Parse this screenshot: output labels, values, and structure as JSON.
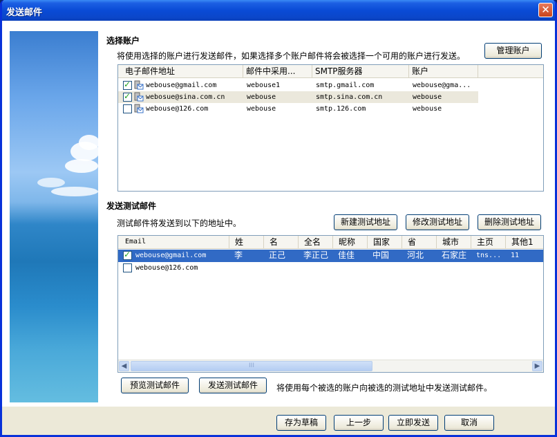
{
  "window": {
    "title": "发送邮件",
    "close_label": "✕"
  },
  "accounts_section": {
    "title": "选择账户",
    "description": "将使用选择的账户进行发送邮件，如果选择多个账户邮件将会被选择一个可用的账户进行发送。",
    "manage_button": "管理账户",
    "columns": [
      "电子邮件地址",
      "邮件中采用...",
      "SMTP服务器",
      "账户"
    ],
    "rows": [
      {
        "checked": true,
        "email": "webouse@gmail.com",
        "name": "webouse1",
        "smtp": "smtp.gmail.com",
        "account": "webouse@gma..."
      },
      {
        "checked": true,
        "email": "webosue@sina.com.cn",
        "name": "webouse",
        "smtp": "smtp.sina.com.cn",
        "account": "webouse"
      },
      {
        "checked": false,
        "email": "webouse@126.com",
        "name": "webouse",
        "smtp": "smtp.126.com",
        "account": "webouse"
      }
    ]
  },
  "test_section": {
    "title": "发送测试邮件",
    "description": "测试邮件将发送到以下的地址中。",
    "new_button": "新建测试地址",
    "edit_button": "修改测试地址",
    "delete_button": "删除测试地址",
    "columns": [
      "Email",
      "姓",
      "名",
      "全名",
      "昵称",
      "国家",
      "省",
      "城市",
      "主页",
      "其他1"
    ],
    "rows": [
      {
        "checked": true,
        "selected": true,
        "cells": [
          "webouse@gmail.com",
          "李",
          "正己",
          "李正己",
          "佳佳",
          "中国",
          "河北",
          "石家庄",
          "tns...",
          "11"
        ]
      },
      {
        "checked": false,
        "selected": false,
        "cells": [
          "webouse@126.com",
          "",
          "",
          "",
          "",
          "",
          "",
          "",
          "",
          ""
        ]
      }
    ],
    "scroll_grip": "III",
    "preview_button": "预览测试邮件",
    "send_test_button": "发送测试邮件",
    "send_note": "将使用每个被选的账户向被选的测试地址中发送测试邮件。"
  },
  "footer": {
    "save_draft": "存为草稿",
    "previous": "上一步",
    "send_now": "立即发送",
    "cancel": "取消"
  },
  "colors": {
    "title_bar": "#0a4bd6",
    "selection": "#316ac5",
    "highlight_row": "#ebe8dc",
    "dialog_bg": "#ece9d8"
  }
}
